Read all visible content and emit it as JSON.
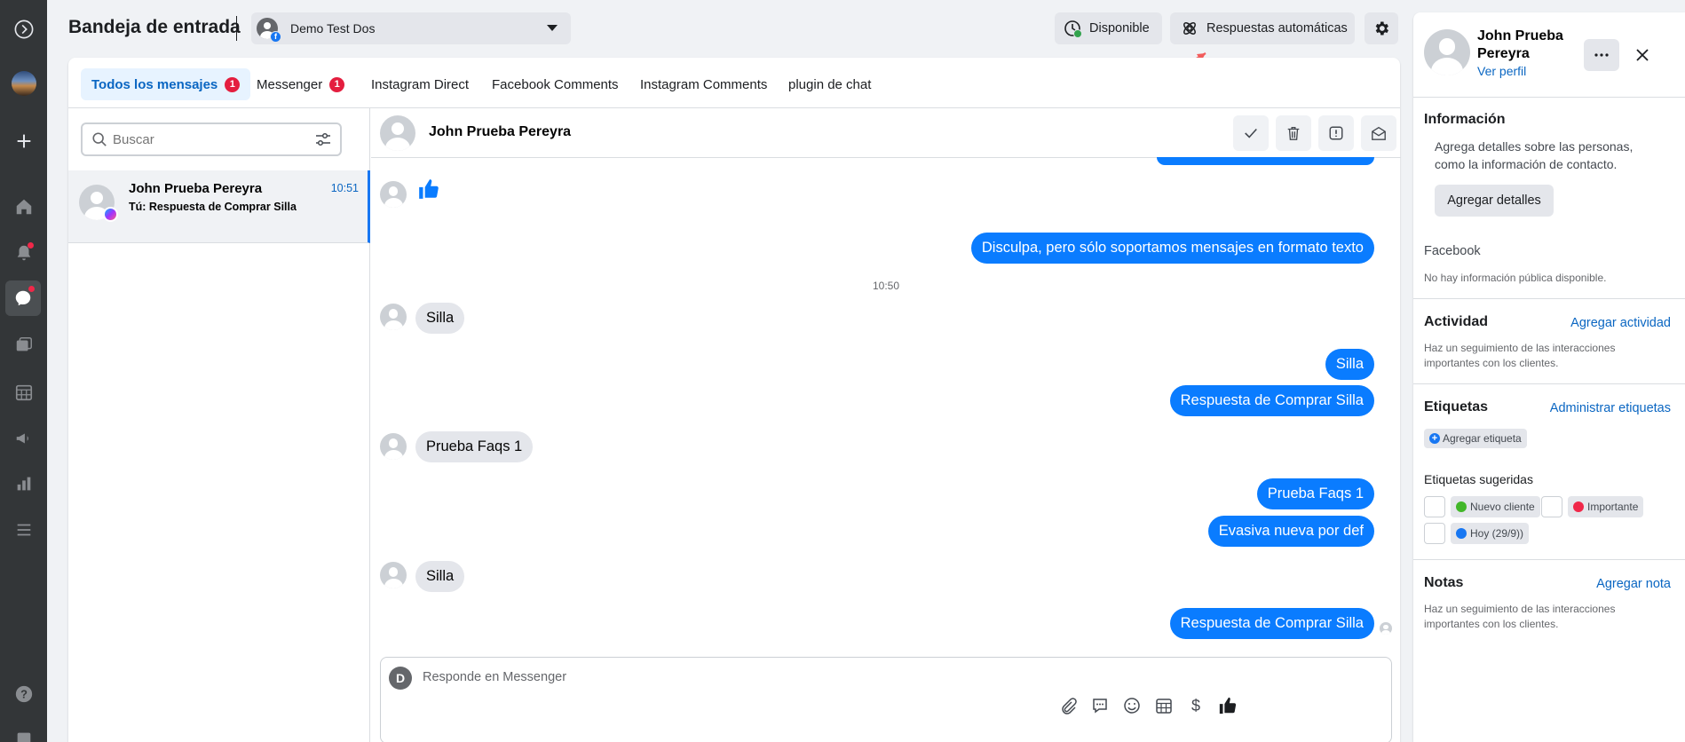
{
  "header": {
    "title": "Bandeja de entrada",
    "page_name": "Demo Test Dos",
    "status_label": "Disponible",
    "auto_replies_label": "Respuestas automáticas"
  },
  "tabs": [
    {
      "label": "Todos los mensajes",
      "badge": "1"
    },
    {
      "label": "Messenger",
      "badge": "1"
    },
    {
      "label": "Instagram Direct"
    },
    {
      "label": "Facebook Comments"
    },
    {
      "label": "Instagram Comments"
    },
    {
      "label": "plugin de chat"
    }
  ],
  "search": {
    "placeholder": "Buscar"
  },
  "conversations": [
    {
      "name": "John Prueba Pereyra",
      "preview": "Tú: Respuesta de Comprar Silla",
      "time": "10:51"
    }
  ],
  "chat": {
    "contact_name": "John Prueba Pereyra",
    "timestamp_divider": "10:50",
    "messages": [
      {
        "dir": "in",
        "type": "like"
      },
      {
        "dir": "out",
        "text": "Disculpa, pero sólo soportamos mensajes en formato texto"
      },
      {
        "dir": "in",
        "text": "Silla"
      },
      {
        "dir": "out",
        "text": "Silla"
      },
      {
        "dir": "out",
        "text": "Respuesta de Comprar Silla"
      },
      {
        "dir": "in",
        "text": "Prueba Faqs 1"
      },
      {
        "dir": "out",
        "text": "Prueba Faqs 1"
      },
      {
        "dir": "out",
        "text": "Evasiva nueva por def"
      },
      {
        "dir": "in",
        "text": "Silla"
      },
      {
        "dir": "out",
        "text": "Respuesta de Comprar Silla"
      }
    ],
    "composer_placeholder": "Responde en Messenger",
    "composer_avatar_letter": "D"
  },
  "profile": {
    "name": "John Prueba Pereyra",
    "view_profile": "Ver perfil",
    "info_title": "Información",
    "info_desc": "Agrega detalles sobre las personas, como la información de contacto.",
    "add_details": "Agregar detalles",
    "facebook_title": "Facebook",
    "facebook_desc": "No hay información pública disponible.",
    "activity_title": "Actividad",
    "activity_link": "Agregar actividad",
    "activity_desc": "Haz un seguimiento de las interacciones importantes con los clientes.",
    "labels_title": "Etiquetas",
    "labels_link": "Administrar etiquetas",
    "add_label": "Agregar etiqueta",
    "suggested_title": "Etiquetas sugeridas",
    "suggested": [
      {
        "label": "Nuevo cliente",
        "color": "#42b72a"
      },
      {
        "label": "Importante",
        "color": "#f02849"
      },
      {
        "label": "Hoy (29/9))",
        "color": "#1877f2"
      }
    ],
    "notes_title": "Notas",
    "notes_link": "Agregar nota",
    "notes_desc": "Haz un seguimiento de las interacciones importantes con los clientes."
  },
  "colors": {
    "accent": "#0a7cff",
    "rail": "#333638",
    "badge": "#e41e3f",
    "link": "#0a66c2",
    "arrow": "#f25c5c"
  }
}
